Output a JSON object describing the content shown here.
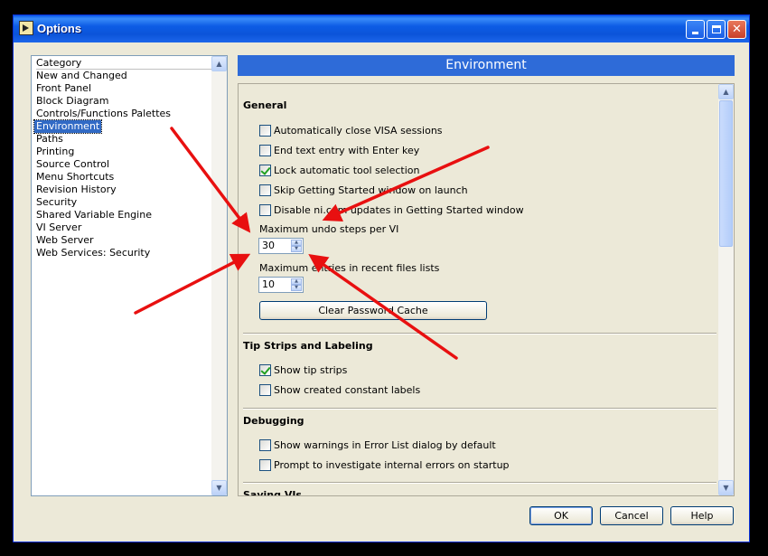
{
  "window": {
    "title": "Options"
  },
  "category_list": {
    "header": "Category",
    "items": [
      {
        "label": "New and Changed"
      },
      {
        "label": "Front Panel"
      },
      {
        "label": "Block Diagram"
      },
      {
        "label": "Controls/Functions Palettes"
      },
      {
        "label": "Environment",
        "selected": true
      },
      {
        "label": "Paths"
      },
      {
        "label": "Printing"
      },
      {
        "label": "Source Control"
      },
      {
        "label": "Menu Shortcuts"
      },
      {
        "label": "Revision History"
      },
      {
        "label": "Security"
      },
      {
        "label": "Shared Variable Engine"
      },
      {
        "label": "VI Server"
      },
      {
        "label": "Web Server"
      },
      {
        "label": "Web Services: Security"
      }
    ]
  },
  "panel": {
    "title": "Environment",
    "general": {
      "title": "General",
      "checkboxes": [
        {
          "label": "Automatically close VISA sessions",
          "checked": false
        },
        {
          "label": "End text entry with Enter key",
          "checked": false
        },
        {
          "label": "Lock automatic tool selection",
          "checked": true
        },
        {
          "label": "Skip Getting Started window on launch",
          "checked": false
        },
        {
          "label": "Disable ni.com updates in Getting Started window",
          "checked": false
        }
      ],
      "undo_label": "Maximum undo steps per VI",
      "undo_value": "30",
      "recent_label": "Maximum entries in recent files lists",
      "recent_value": "10",
      "clear_cache_label": "Clear Password Cache"
    },
    "tip_strips": {
      "title": "Tip Strips and Labeling",
      "checkboxes": [
        {
          "label": "Show tip strips",
          "checked": true
        },
        {
          "label": "Show created constant labels",
          "checked": false
        }
      ]
    },
    "debugging": {
      "title": "Debugging",
      "checkboxes": [
        {
          "label": "Show warnings in Error List dialog by default",
          "checked": false
        },
        {
          "label": "Prompt to investigate internal errors on startup",
          "checked": false
        }
      ]
    },
    "saving": {
      "title": "Saving VIs"
    }
  },
  "buttons": {
    "ok": "OK",
    "cancel": "Cancel",
    "help": "Help"
  },
  "colors": {
    "title_bar": "#0b54d9",
    "selection": "#316ac5",
    "header_bar": "#2e6bd8",
    "annotation_arrow": "#e81010"
  }
}
